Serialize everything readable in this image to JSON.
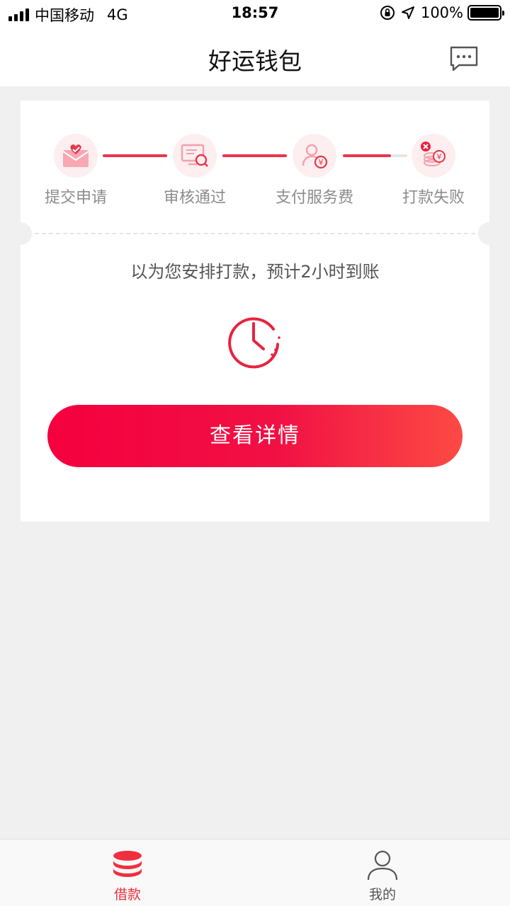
{
  "status_bar": {
    "carrier": "中国移动",
    "network": "4G",
    "time": "18:57",
    "battery": "100%"
  },
  "nav": {
    "title": "好运钱包",
    "message_icon": "chat-bubble-icon"
  },
  "steps": [
    {
      "label": "提交申请",
      "icon": "envelope-heart-icon"
    },
    {
      "label": "审核通过",
      "icon": "monitor-search-icon"
    },
    {
      "label": "支付服务费",
      "icon": "user-yuan-icon"
    },
    {
      "label": "打款失败",
      "icon": "coins-error-icon"
    }
  ],
  "status_message": "以为您安排打款，预计2小时到账",
  "status_icon": "clock-icon",
  "detail_button": "查看详情",
  "tabs": [
    {
      "label": "借款",
      "icon": "coin-stack-icon",
      "active": true
    },
    {
      "label": "我的",
      "icon": "person-icon",
      "active": false
    }
  ],
  "colors": {
    "accent": "#f5003e",
    "accent_end": "#fc4a44",
    "step_bg": "#fdeef0",
    "inactive_text": "#8c8c8c"
  }
}
